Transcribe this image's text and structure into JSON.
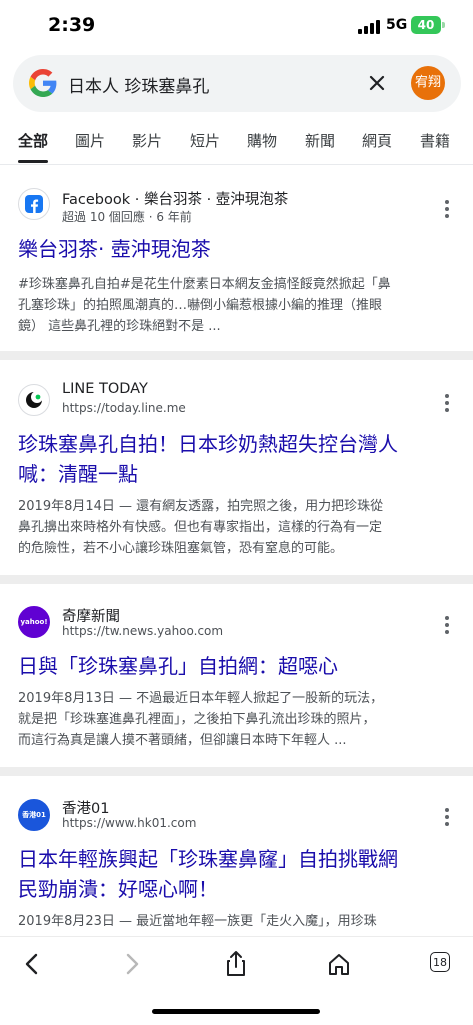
{
  "status": {
    "time": "2:39",
    "network": "5G",
    "battery": "40"
  },
  "search": {
    "query": "日本人 珍珠塞鼻孔",
    "avatar_text": "宥翔"
  },
  "tabs": [
    "全部",
    "圖片",
    "影片",
    "短片",
    "購物",
    "新聞",
    "網頁",
    "書籍"
  ],
  "active_tab": "全部",
  "results": [
    {
      "source": "Facebook · 樂台羽茶 · 壺沖現泡茶",
      "meta": "超過 10 個回應 · 6 年前",
      "title_lines": [
        "樂台羽茶· 壺沖現泡茶"
      ],
      "snippet_lines": [
        "#珍珠塞鼻孔自拍#是花生什麼素日本網友金搞怪餒竟然掀起「鼻",
        "孔塞珍珠」的拍照風潮真的…嚇倒小編惹根據小編的推理（推眼",
        "鏡） 這些鼻孔裡的珍珠絕對不是 ..."
      ],
      "icon": "facebook-icon"
    },
    {
      "source": "LINE TODAY",
      "meta": "https://today.line.me",
      "title_lines": [
        "珍珠塞鼻孔自拍！日本珍奶熱超失控台灣人",
        "喊：清醒一點"
      ],
      "snippet_lines": [
        "2019年8月14日 — 還有網友透露，拍完照之後，用力把珍珠從",
        "鼻孔擤出來時格外有快感。但也有專家指出，這樣的行為有一定",
        "的危險性，若不小心讓珍珠阻塞氣管，恐有窒息的可能。"
      ],
      "icon": "line-today-icon"
    },
    {
      "source": "奇摩新聞",
      "meta": "https://tw.news.yahoo.com",
      "title_lines": [
        "日與「珍珠塞鼻孔」自拍網：超噁心"
      ],
      "snippet_lines": [
        "2019年8月13日 — 不過最近日本年輕人掀起了一股新的玩法，",
        "就是把「珍珠塞進鼻孔裡面」，之後拍下鼻孔流出珍珠的照片，",
        "而這行為真是讓人摸不著頭緒，但卻讓日本時下年輕人 ..."
      ],
      "icon": "yahoo-icon",
      "icon_text": "yahoo!"
    },
    {
      "source": "香港01",
      "meta": "https://www.hk01.com",
      "title_lines": [
        "日本年輕族興起「珍珠塞鼻窿」自拍挑戰網",
        "民勁崩潰：好噁心啊！"
      ],
      "snippet_lines": [
        "2019年8月23日 — 最近當地年輕一族更「走火入魔」，用珍珠"
      ],
      "icon": "hk01-icon",
      "icon_text": "香港01"
    }
  ],
  "toolbar": {
    "tab_count": "18"
  },
  "colors": {
    "link": "#1a0dab",
    "avatar": "#e8710a",
    "battery": "#34c759",
    "facebook": "#1877f2",
    "yahoo": "#6001d2",
    "hk01": "#1a56db"
  }
}
